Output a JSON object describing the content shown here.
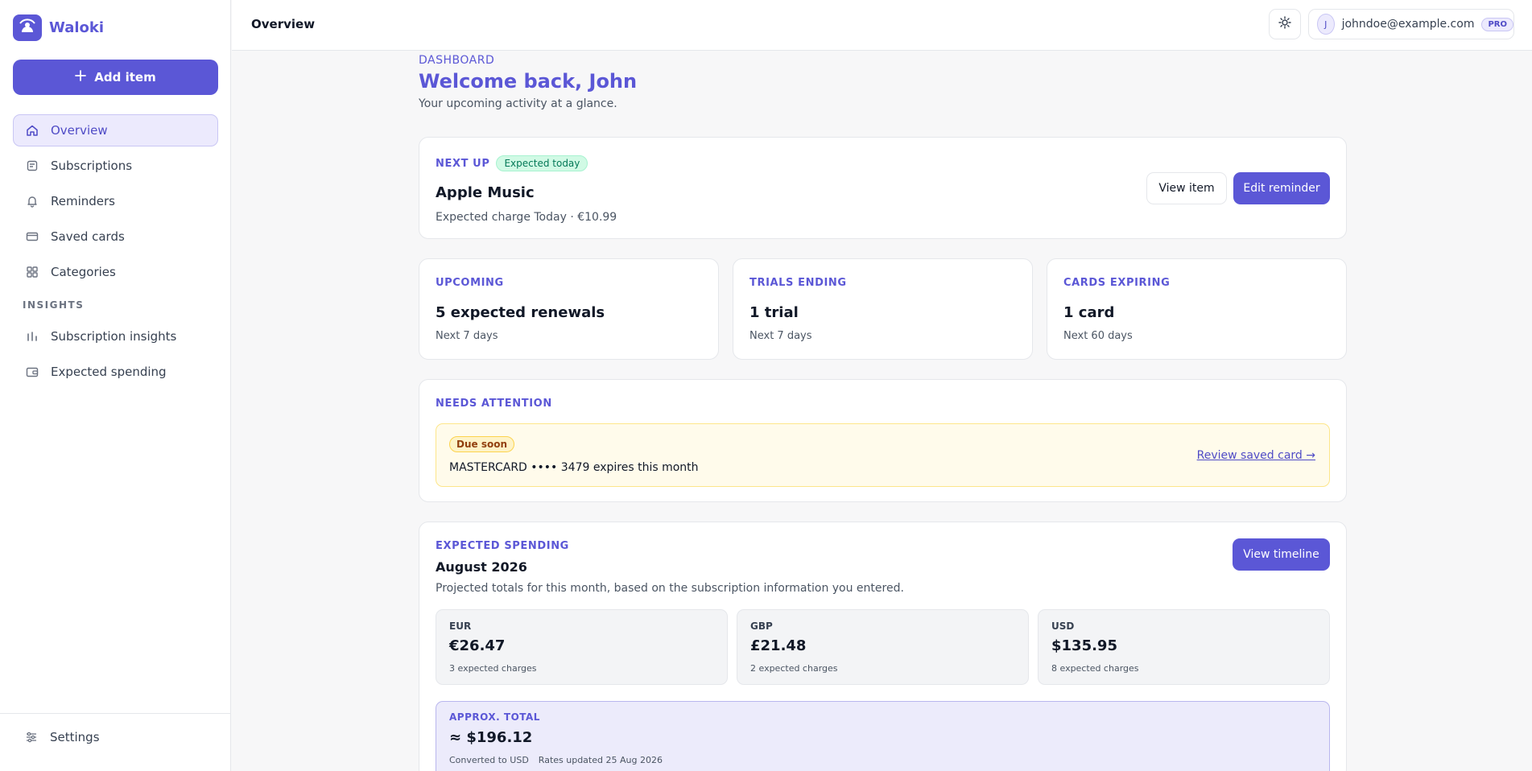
{
  "app": {
    "name": "Waloki",
    "accent": "#5b57d6"
  },
  "sidebar": {
    "add_label": "Add item",
    "items": [
      {
        "label": "Overview",
        "icon": "home-icon",
        "active": true
      },
      {
        "label": "Subscriptions",
        "icon": "receipt-icon"
      },
      {
        "label": "Reminders",
        "icon": "bell-icon"
      },
      {
        "label": "Saved cards",
        "icon": "credit-card-icon"
      },
      {
        "label": "Categories",
        "icon": "grid-icon"
      }
    ],
    "insights_label": "INSIGHTS",
    "insights": [
      {
        "label": "Subscription insights",
        "icon": "bar-chart-icon"
      },
      {
        "label": "Expected spending",
        "icon": "wallet-icon"
      }
    ],
    "settings_label": "Settings"
  },
  "topbar": {
    "title": "Overview",
    "avatar_initial": "J",
    "email": "johndoe@example.com",
    "plan": "PRO"
  },
  "header": {
    "eyebrow": "DASHBOARD",
    "title": "Welcome back, John",
    "subtitle": "Your upcoming activity at a glance."
  },
  "next_up": {
    "label": "NEXT UP",
    "badge": "Expected today",
    "name": "Apple Music",
    "detail": "Expected charge Today · €10.99",
    "view_label": "View item",
    "edit_label": "Edit reminder"
  },
  "stats": [
    {
      "label": "UPCOMING",
      "value": "5 expected renewals",
      "sub": "Next 7 days"
    },
    {
      "label": "TRIALS ENDING",
      "value": "1 trial",
      "sub": "Next 7 days"
    },
    {
      "label": "CARDS EXPIRING",
      "value": "1 card",
      "sub": "Next 60 days"
    }
  ],
  "attention": {
    "label": "NEEDS ATTENTION",
    "badge": "Due soon",
    "text": "MASTERCARD •••• 3479 expires this month",
    "link": "Review saved card →"
  },
  "spending": {
    "label": "EXPECTED SPENDING",
    "month": "August 2026",
    "subtitle": "Projected totals for this month, based on the subscription information you entered.",
    "button": "View timeline",
    "currencies": [
      {
        "code": "EUR",
        "amount": "€26.47",
        "count": "3 expected charges"
      },
      {
        "code": "GBP",
        "amount": "£21.48",
        "count": "2 expected charges"
      },
      {
        "code": "USD",
        "amount": "$135.95",
        "count": "8 expected charges"
      }
    ],
    "total_label": "APPROX. TOTAL",
    "total_amount": "≈ $196.12",
    "converted": "Converted to USD",
    "rates": "Rates updated 25 Aug 2026"
  }
}
